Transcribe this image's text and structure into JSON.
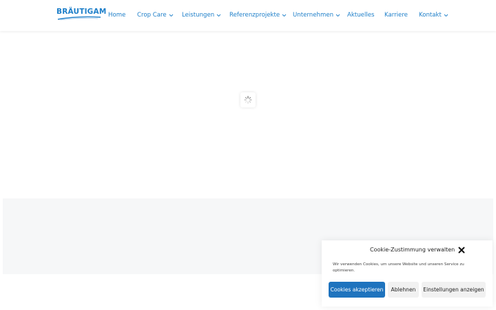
{
  "header": {
    "logo_text": "BRÄUTIGAM",
    "nav": [
      {
        "label": "Home",
        "dropdown": false
      },
      {
        "label": "Crop Care",
        "dropdown": true
      },
      {
        "label": "Leistungen",
        "dropdown": true
      },
      {
        "label": "Referenzprojekte",
        "dropdown": true
      },
      {
        "label": "Unternehmen",
        "dropdown": true
      },
      {
        "label": "Aktuelles",
        "dropdown": false
      },
      {
        "label": "Karriere",
        "dropdown": false
      },
      {
        "label": "Kontakt",
        "dropdown": true
      }
    ]
  },
  "cookie": {
    "title": "Cookie-Zustimmung verwalten",
    "text": "Wir verwenden Cookies, um unsere Website und unseren Service zu optimieren.",
    "accept_label": "Cookies akzeptieren",
    "deny_label": "Ablehnen",
    "settings_label": "Einstellungen anzeigen"
  },
  "colors": {
    "brand": "#1e7fc9",
    "accept_button": "#1e73be",
    "section_bg": "#f6f7f8"
  },
  "icons": {
    "dropdown": "chevron-down-icon",
    "close": "close-icon",
    "loading": "spinner-icon"
  }
}
